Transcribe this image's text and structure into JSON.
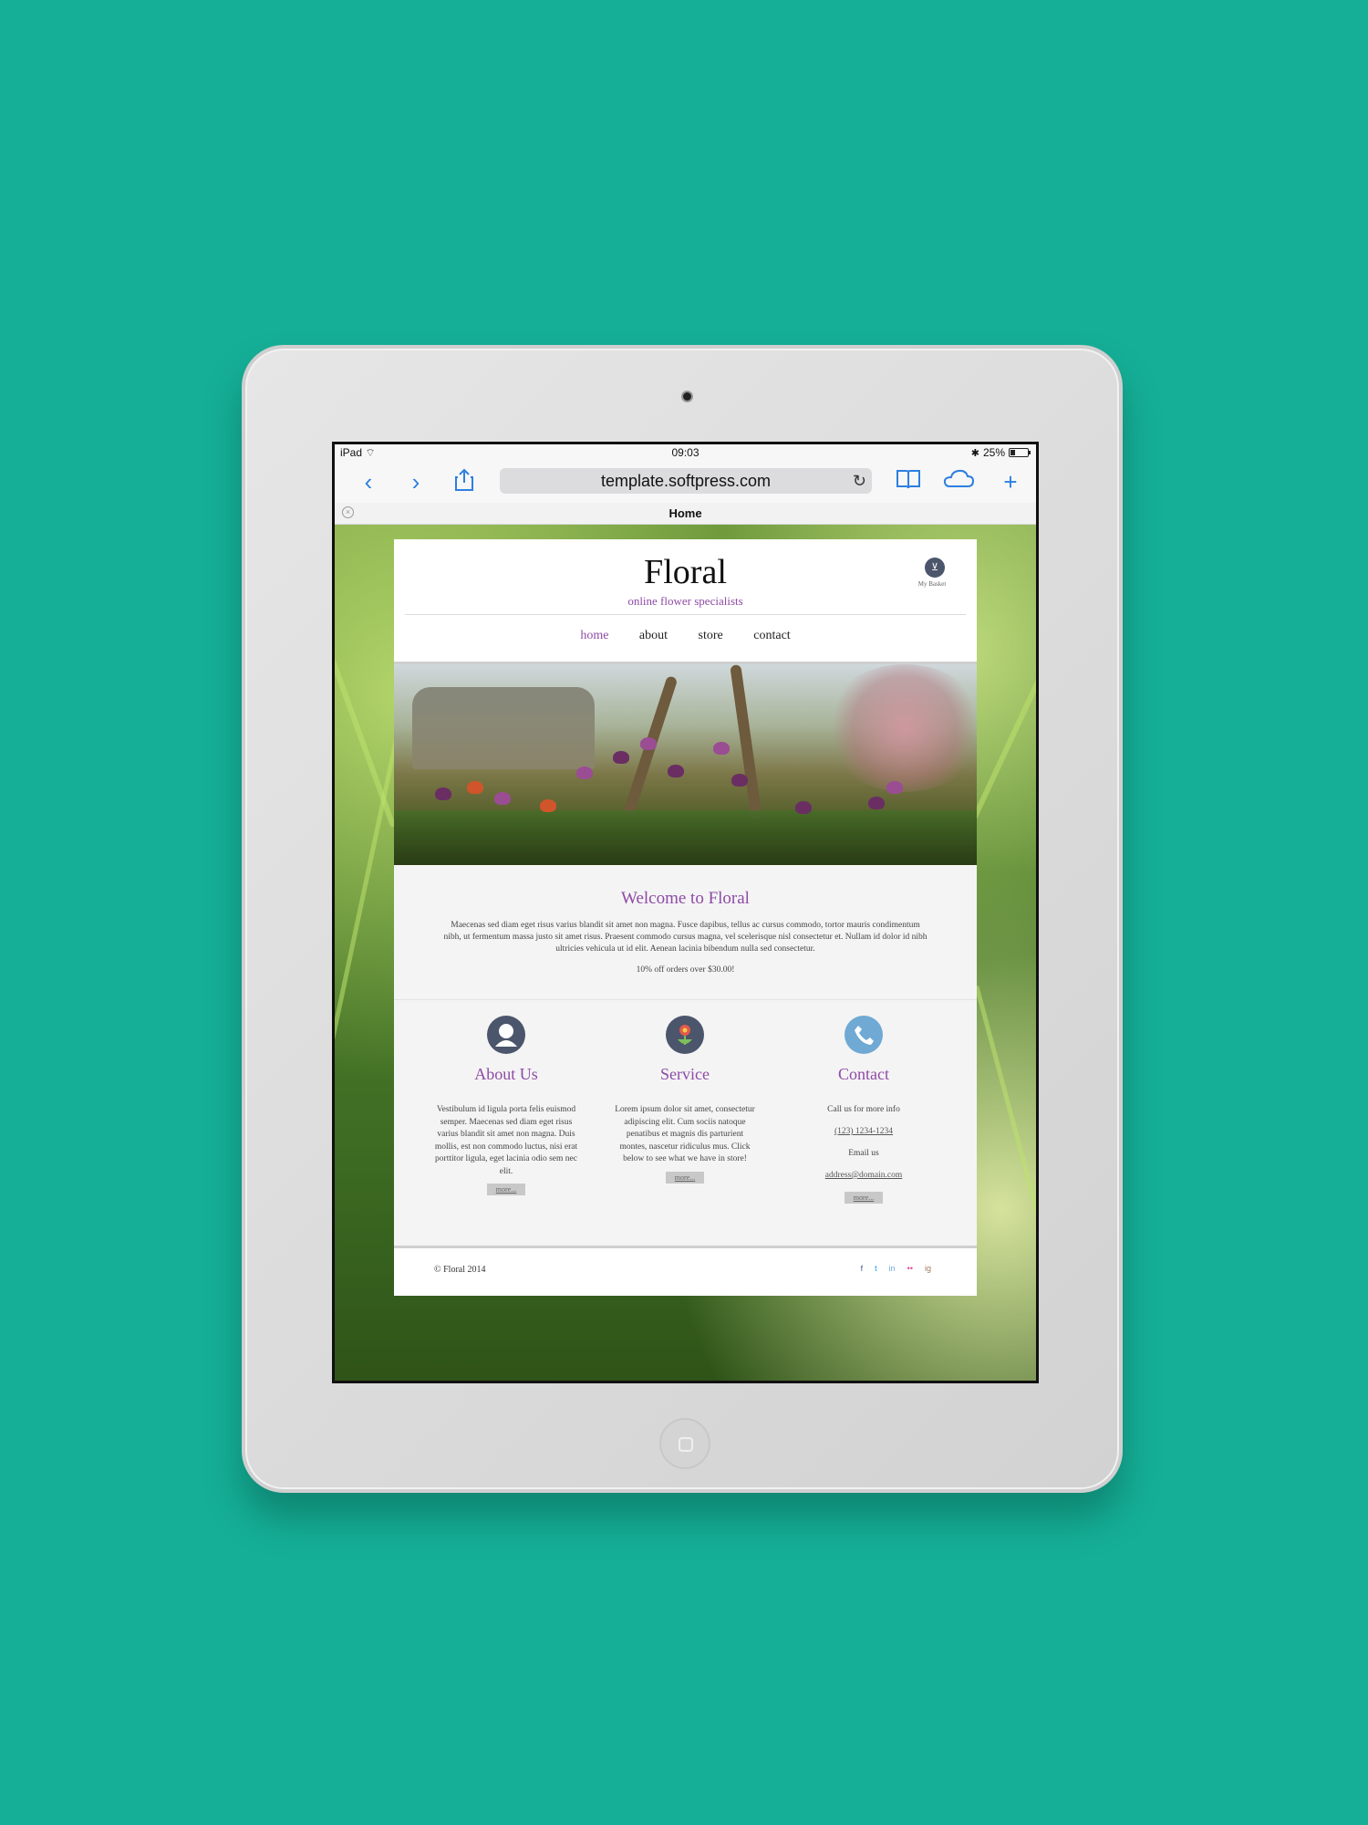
{
  "status_bar": {
    "device": "iPad",
    "time": "09:03",
    "battery": "25%"
  },
  "browser": {
    "url": "template.softpress.com",
    "tab_title": "Home",
    "icons": [
      "back-icon",
      "forward-icon",
      "share-icon",
      "reload-icon",
      "bookmarks-icon",
      "icloud-tabs-icon",
      "new-tab-icon",
      "close-tab-icon"
    ]
  },
  "site": {
    "logo": "Floral",
    "tagline": "online flower specialists",
    "basket_label": "My Basket",
    "nav": [
      {
        "label": "home",
        "active": true
      },
      {
        "label": "about",
        "active": false
      },
      {
        "label": "store",
        "active": false
      },
      {
        "label": "contact",
        "active": false
      }
    ],
    "welcome": {
      "title": "Welcome to Floral",
      "text": "Maecenas sed diam eget risus varius blandit sit amet non magna. Fusce dapibus, tellus ac cursus commodo, tortor mauris condimentum nibh, ut fermentum massa justo sit amet risus. Praesent commodo cursus magna, vel scelerisque nisl consectetur et. Nullam id dolor id nibh ultricies vehicula ut id elit. Aenean lacinia bibendum nulla sed consectetur.",
      "promo": "10% off orders over $30.00!"
    },
    "columns": {
      "about": {
        "title": "About Us",
        "text": "Vestibulum id ligula porta felis euismod semper. Maecenas sed diam eget risus varius blandit sit amet non magna. Duis mollis, est non commodo luctus, nisi erat porttitor ligula, eget lacinia odio sem nec elit.",
        "button": "more..."
      },
      "service": {
        "title": "Service",
        "text": "Lorem ipsum dolor sit amet, consectetur adipiscing elit. Cum sociis natoque penatibus et magnis dis parturient montes, nascetur ridiculus mus. Click below to see what we have in store!",
        "button": "more..."
      },
      "contact": {
        "title": "Contact",
        "call_text": "Call us for more info",
        "phone": "(123) 1234-1234",
        "email_text": "Email us",
        "email": "address@domain.com",
        "button": "more..."
      }
    },
    "footer": {
      "copyright": "© Floral 2014",
      "social": [
        "f",
        "t",
        "in",
        "••",
        "ig"
      ]
    },
    "colors": {
      "accent": "#8e4aa6",
      "icon_dark": "#4b556b",
      "icon_light": "#6fa9d4",
      "background": "#15af97"
    }
  }
}
